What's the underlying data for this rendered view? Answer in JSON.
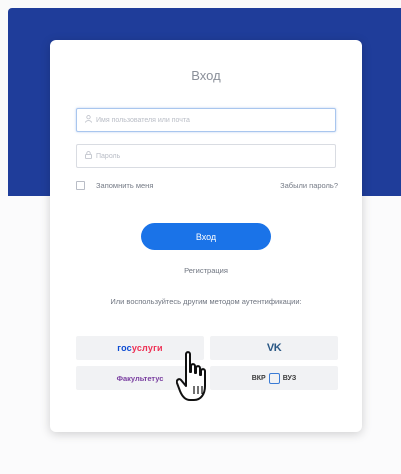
{
  "card": {
    "title": "Вход"
  },
  "form": {
    "username_placeholder": "Имя пользователя или почта",
    "password_placeholder": "Пароль",
    "remember_label": "Запомнить меня",
    "remember_checked": false,
    "forgot_link": "Забыли пароль?",
    "login_button": "Вход",
    "register_link": "Регистрация",
    "user_icon": "user-icon",
    "lock_icon": "lock-icon"
  },
  "alternative": {
    "text": "Или воспользуйтесь другим методом аутентификации:"
  },
  "providers": {
    "gosuslugi_part1": "гос",
    "gosuslugi_part2": "услуги",
    "vk": "VK",
    "faculty": "Факультетус",
    "vkr_left": "ВКР",
    "vkr_right": "ВУЗ"
  },
  "colors": {
    "header_band": "#1f3d9a",
    "primary_button": "#1a73e8",
    "gos_blue": "#0d4cd3",
    "gos_red": "#ee2f53",
    "vk_blue": "#2a5885"
  }
}
